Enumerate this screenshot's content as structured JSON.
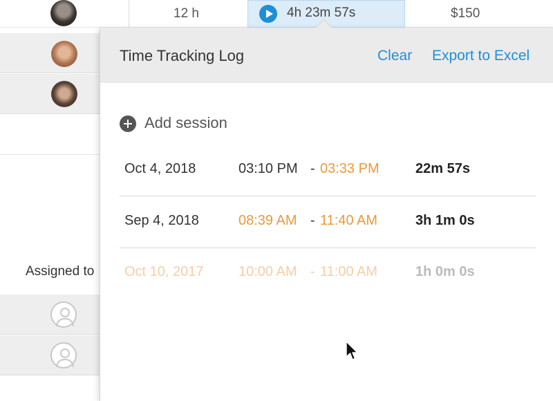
{
  "table": {
    "row1": {
      "hours": "12 h",
      "timer": "4h 23m 57s",
      "cost": "$150"
    },
    "assigned_label": "Assigned to"
  },
  "popover": {
    "title": "Time Tracking Log",
    "clear_label": "Clear",
    "export_label": "Export to Excel",
    "add_session_label": "Add session",
    "sessions": [
      {
        "date": "Oct 4, 2018",
        "start": "03:10 PM",
        "end": "03:33 PM",
        "duration": "22m 57s"
      },
      {
        "date": "Sep 4, 2018",
        "start": "08:39 AM",
        "end": "11:40 AM",
        "duration": "3h 1m 0s"
      },
      {
        "date": "Oct 10, 2017",
        "start": "10:00 AM",
        "end": "11:00 AM",
        "duration": "1h 0m 0s"
      }
    ],
    "separator": "-"
  },
  "icons": {
    "play": "play-icon",
    "add": "plus-circle-icon",
    "placeholder_avatar": "user-icon",
    "cursor": "arrow-cursor-icon"
  },
  "colors": {
    "accent": "#1e8fd6",
    "highlight_time": "#e89a3c",
    "timer_bg": "#dcecf8",
    "header_bg": "#ebebeb"
  }
}
